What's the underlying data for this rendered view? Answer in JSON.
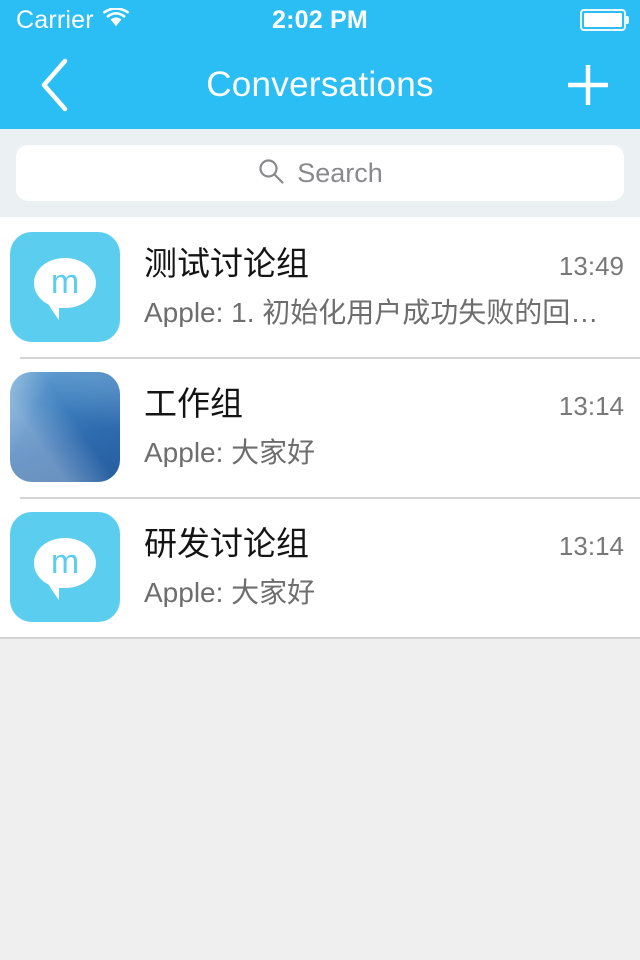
{
  "status_bar": {
    "carrier": "Carrier",
    "wifi_icon": "wifi-icon",
    "time": "2:02 PM",
    "battery_icon": "battery-icon",
    "battery_level_percent": 100,
    "background_color": "#2BBEF4",
    "text_color": "#FFFFFF"
  },
  "nav_bar": {
    "title": "Conversations",
    "back_icon": "chevron-left-icon",
    "add_icon": "plus-icon",
    "background_color": "#2BBEF4",
    "tint_color": "#FFFFFF"
  },
  "search": {
    "placeholder": "Search",
    "value": "",
    "icon": "search-icon",
    "container_color": "#EBF0F3",
    "field_color": "#FFFFFF"
  },
  "conversations": [
    {
      "title": "测试讨论组",
      "time": "13:49",
      "preview": "Apple: 1. 初始化用户成功失败的回调…",
      "avatar_type": "cyan-bubble",
      "avatar_letter": "m",
      "avatar_color": "#5BCEF0"
    },
    {
      "title": "工作组",
      "time": "13:14",
      "preview": "Apple: 大家好",
      "avatar_type": "blue-gradient",
      "avatar_letter": "",
      "avatar_color": "#3E7FBE"
    },
    {
      "title": "研发讨论组",
      "time": "13:14",
      "preview": "Apple: 大家好",
      "avatar_type": "cyan-bubble",
      "avatar_letter": "m",
      "avatar_color": "#5BCEF0"
    }
  ],
  "theme": {
    "page_background": "#EFEFEF",
    "row_background": "#FFFFFF",
    "separator_color": "#D4D4D4",
    "title_color": "#141414",
    "preview_color": "#6E6E6E",
    "time_color": "#787878"
  }
}
